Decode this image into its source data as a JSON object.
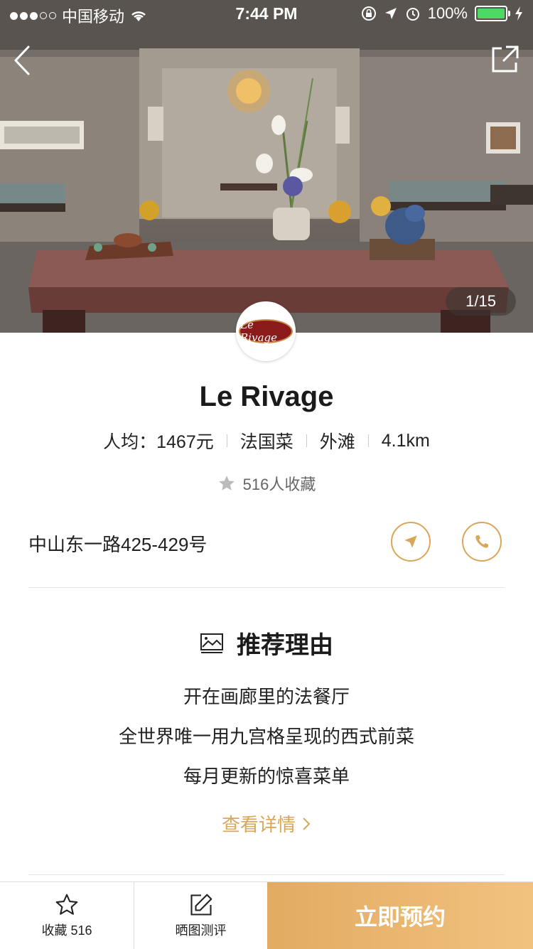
{
  "status_bar": {
    "carrier": "中国移动",
    "time": "7:44 PM",
    "battery": "100%"
  },
  "hero": {
    "counter": "1/15"
  },
  "logo": {
    "text": "Le Rivage"
  },
  "restaurant": {
    "name": "Le Rivage",
    "price": "人均：1467元",
    "cuisine": "法国菜",
    "area": "外滩",
    "distance": "4.1km",
    "favorites": "516人收藏",
    "address": "中山东一路425-429号"
  },
  "recommend": {
    "heading": "推荐理由",
    "reasons": [
      "开在画廊里的法餐厅",
      "全世界唯一用九宫格呈现的西式前菜",
      "每月更新的惊喜菜单"
    ],
    "more_label": "查看详情"
  },
  "bottom_bar": {
    "collect_label": "收藏 516",
    "review_label": "晒图测评",
    "book_label": "立即预约"
  },
  "colors": {
    "accent": "#d9a75a",
    "book_start": "#e2ab62",
    "book_end": "#f1c27f",
    "battery": "#4cd964"
  }
}
